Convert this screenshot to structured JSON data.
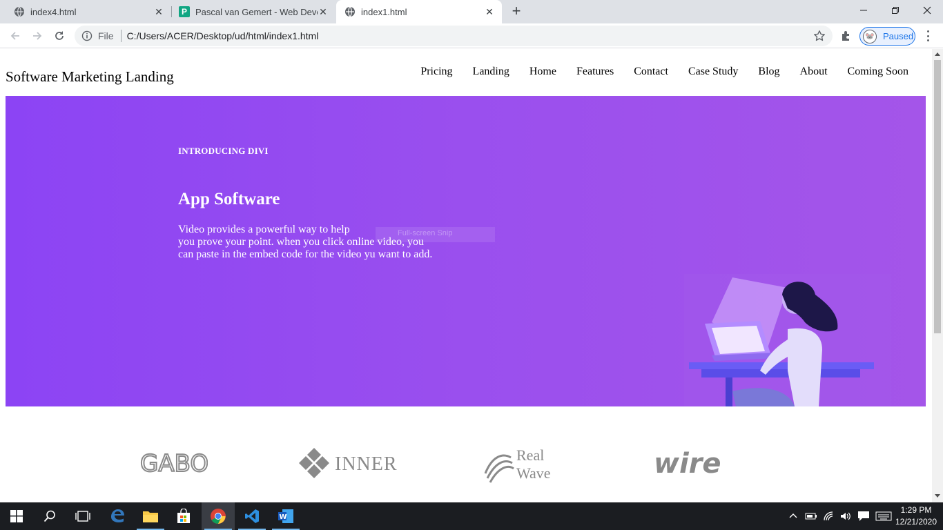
{
  "browser": {
    "tabs": [
      {
        "title": "index4.html",
        "favicon": "globe-icon",
        "active": false
      },
      {
        "title": "Pascal van Gemert - Web Develo",
        "favicon": "p-favicon-icon",
        "favicon_text": "P",
        "active": false
      },
      {
        "title": "index1.html",
        "favicon": "globe-icon",
        "active": true
      }
    ],
    "address": {
      "scheme_label": "File",
      "url": "C:/Users/ACER/Desktop/ud/html/index1.html"
    },
    "profile": {
      "label": "Paused"
    },
    "colors": {
      "tabstrip": "#dee1e6",
      "omnibox": "#f1f3f4",
      "accent": "#1a73e8",
      "favicon_p": "#11a683"
    }
  },
  "page": {
    "site_title": "Software Marketing Landing",
    "nav": [
      "Pricing",
      "Landing",
      "Home",
      "Features",
      "Contact",
      "Case Study",
      "Blog",
      "About",
      "Coming Soon"
    ],
    "hero": {
      "eyebrow": "INTRODUCING DIVI",
      "heading": "App Software",
      "body_lines": [
        "Video provides a powerful way to help",
        "you prove your point. when you click online video, you",
        "can paste in the embed code for the video yu want to add."
      ],
      "colors": {
        "gradient_start": "#8c44f4",
        "gradient_end": "#a455e9"
      }
    },
    "overlay_text": "Full-screen Snip",
    "logos": [
      {
        "name": "GABO",
        "text": "GABO"
      },
      {
        "name": "INNER",
        "text": "INNER"
      },
      {
        "name": "Real Wave",
        "text_line1": "Real",
        "text_line2": "Wave"
      },
      {
        "name": "wire",
        "text": "wire"
      }
    ]
  },
  "taskbar": {
    "apps": [
      "windows-start-icon",
      "search-icon",
      "task-view-icon",
      "edge-icon",
      "file-explorer-icon",
      "store-icon",
      "chrome-icon",
      "vscode-icon",
      "word-icon"
    ],
    "active_app": "chrome-icon",
    "clock": {
      "time": "1:29 PM",
      "date": "12/21/2020"
    }
  }
}
